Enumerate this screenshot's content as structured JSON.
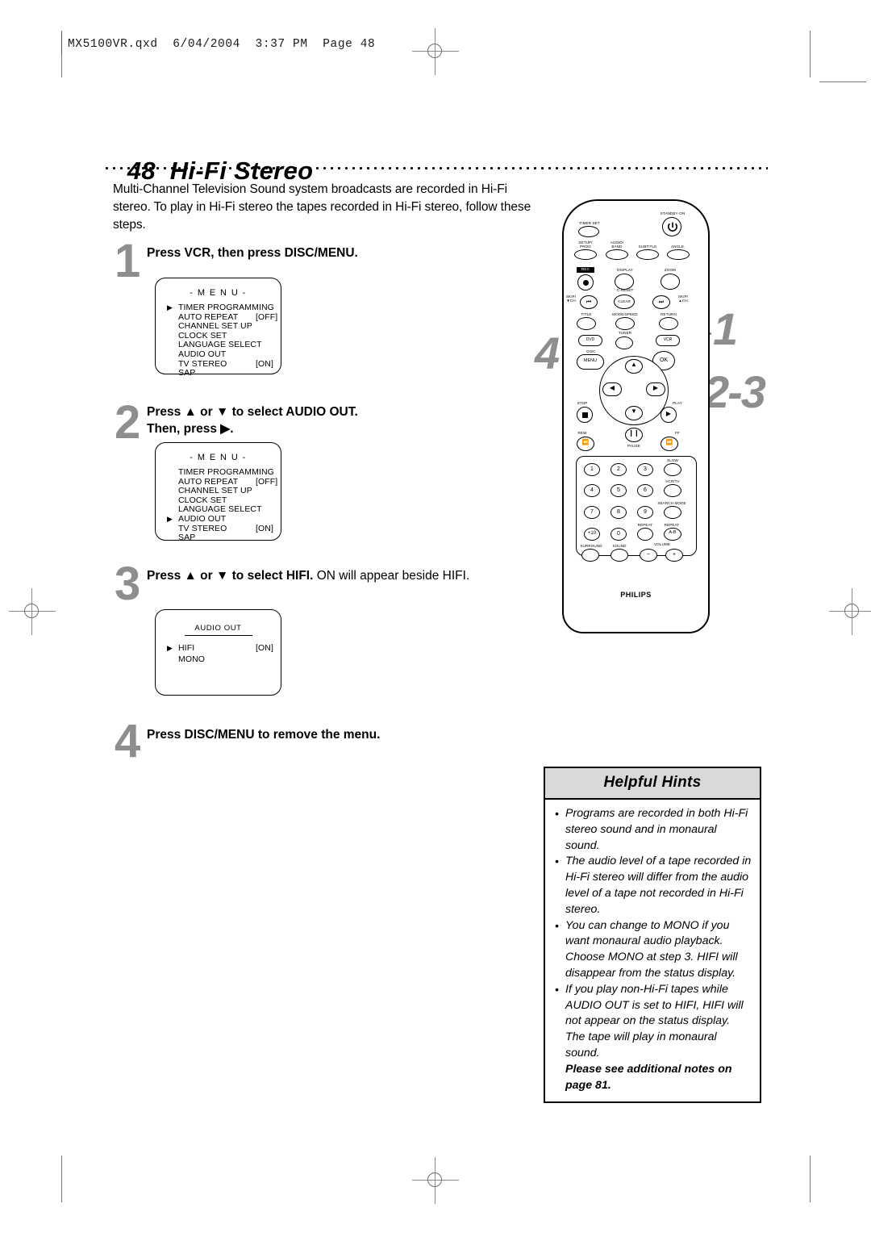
{
  "print_header": "MX5100VR.qxd  6/04/2004  3:37 PM  Page 48",
  "page": {
    "number": "48",
    "title": "Hi-Fi Stereo",
    "intro": "Multi-Channel Television Sound system broadcasts are recorded in Hi-Fi stereo. To play in Hi-Fi stereo the tapes recorded in Hi-Fi stereo, follow these steps."
  },
  "steps": [
    {
      "number": "1",
      "text_bold": "Press VCR, then press DISC/MENU.",
      "text_regular": ""
    },
    {
      "number": "2",
      "text_bold": "Press ▲ or ▼ to select AUDIO OUT.",
      "text_bold2": "Then, press ▶.",
      "text_regular": ""
    },
    {
      "number": "3",
      "text_bold": "Press ▲ or ▼ to select HIFI.",
      "text_regular": " ON will appear beside HIFI."
    },
    {
      "number": "4",
      "text_bold": "Press DISC/MENU to remove the menu.",
      "text_regular": ""
    }
  ],
  "osd_menu_1": {
    "title": "- M E N U -",
    "rows": [
      {
        "pointer": "▶",
        "label": "TIMER PROGRAMMING",
        "value": ""
      },
      {
        "pointer": "",
        "label": "AUTO REPEAT",
        "value": "[OFF]"
      },
      {
        "pointer": "",
        "label": "CHANNEL SET UP",
        "value": ""
      },
      {
        "pointer": "",
        "label": "CLOCK SET",
        "value": ""
      },
      {
        "pointer": "",
        "label": "LANGUAGE SELECT",
        "value": ""
      },
      {
        "pointer": "",
        "label": "AUDIO OUT",
        "value": ""
      },
      {
        "pointer": "",
        "label": "TV STEREO",
        "value": "[ON]"
      },
      {
        "pointer": "",
        "label": "SAP",
        "value": ""
      }
    ]
  },
  "osd_menu_2": {
    "title": "- M E N U -",
    "rows": [
      {
        "pointer": "",
        "label": "TIMER PROGRAMMING",
        "value": ""
      },
      {
        "pointer": "",
        "label": "AUTO REPEAT",
        "value": "[OFF]"
      },
      {
        "pointer": "",
        "label": "CHANNEL SET UP",
        "value": ""
      },
      {
        "pointer": "",
        "label": "CLOCK SET",
        "value": ""
      },
      {
        "pointer": "",
        "label": "LANGUAGE SELECT",
        "value": ""
      },
      {
        "pointer": "▶",
        "label": "AUDIO OUT",
        "value": ""
      },
      {
        "pointer": "",
        "label": "TV STEREO",
        "value": "[ON]"
      },
      {
        "pointer": "",
        "label": "SAP",
        "value": ""
      }
    ]
  },
  "osd_audio_out": {
    "title": "AUDIO OUT",
    "rows": [
      {
        "pointer": "▶",
        "label": "HIFI",
        "value": "[ON]"
      },
      {
        "pointer": "",
        "label": "MONO",
        "value": ""
      }
    ]
  },
  "callouts": {
    "left": "4",
    "right_top": "1",
    "right_bottom": "2-3"
  },
  "remote": {
    "brand": "PHILIPS",
    "labels": {
      "timer_set": "TIMER SET",
      "standby_on": "STANDBY·ON",
      "setup_prog": "SETUP/\nPROG",
      "audio_band": "AUDIO/\nBAND",
      "subtitle": "SUBTITLE",
      "angle": "ANGLE",
      "rec": "REC",
      "display": "DISPLAY",
      "zoom": "ZOOM",
      "skip_down": "SKIP/\n▼CH",
      "skip_up": "SKIP/\n▲CH",
      "c_reset": "C-RESET",
      "clear": "CLEAR",
      "title": "TITLE",
      "mode_speed": "MODE/SPEED",
      "return": "RETURN",
      "dvd": "DVD",
      "tuner": "TUNER",
      "vcr": "VCR",
      "disc": "DISC",
      "menu": "MENU",
      "ok": "OK",
      "stop": "STOP",
      "play": "PLAY",
      "rew": "REW",
      "pause": "PAUSE",
      "ff": "FF",
      "slow": "SLOW",
      "vcr_tv": "VCR/TV",
      "search_mode": "SEARCH MODE",
      "repeat": "REPEAT",
      "repeat_ab": "REPEAT",
      "repeat_ab_btn": "A-B",
      "surround": "SURROUND",
      "sound": "SOUND",
      "volume": "VOLUME",
      "vol_minus": "−",
      "vol_plus": "+"
    },
    "keypad": [
      "1",
      "2",
      "3",
      "4",
      "5",
      "6",
      "7",
      "8",
      "9",
      "+10",
      "0"
    ]
  },
  "helpful_hints": {
    "heading": "Helpful Hints",
    "items": [
      "Programs are recorded in both Hi-Fi stereo sound and in monaural sound.",
      "The audio level of a tape recorded in Hi-Fi stereo will differ from the audio level of a tape not recorded in Hi-Fi stereo.",
      "You can change to MONO if you want monaural audio playback. Choose MONO at step 3. HIFI will disappear from the status display.",
      "If you play non-Hi-Fi tapes while AUDIO OUT is set to HIFI, HIFI will not appear on the status display. The tape will play in monaural sound."
    ],
    "note": "Please see additional notes on page 81.",
    "header_bg": "#d9d9d9"
  }
}
